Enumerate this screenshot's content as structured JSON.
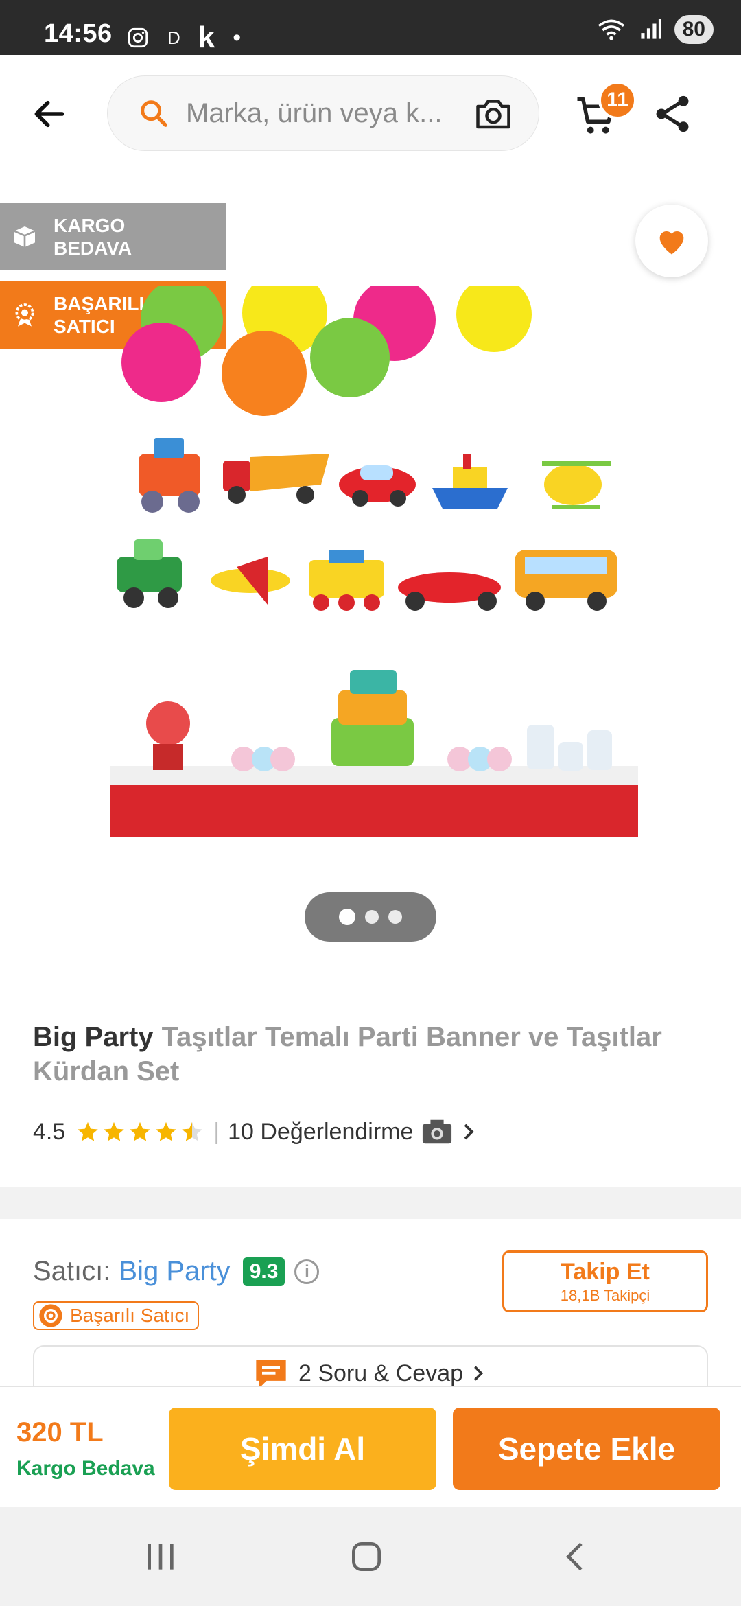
{
  "status_bar": {
    "time": "14:56",
    "notif_letter_d": "D",
    "notif_letter_k": "k",
    "dot": "•",
    "battery": "80"
  },
  "header": {
    "search_placeholder": "Marka, ürün veya k...",
    "cart_count": "11"
  },
  "gallery": {
    "badge_shipping": "KARGO\nBEDAVA",
    "badge_seller": "BAŞARILI\nSATICI",
    "page_count": 3,
    "active_page": 1
  },
  "product": {
    "brand": "Big Party",
    "name": "Taşıtlar Temalı Parti Banner ve Taşıtlar Kürdan Set",
    "rating": "4.5",
    "rating_value": 4.5,
    "review_label": "10 Değerlendirme",
    "separator": "|"
  },
  "seller": {
    "label": "Satıcı:",
    "name": "Big Party",
    "score": "9.3",
    "badge": "Başarılı Satıcı",
    "follow_label": "Takip Et",
    "followers": "18,1B Takipçi",
    "qa_label": "2 Soru & Cevap"
  },
  "purchase": {
    "price": "320 TL",
    "shipping": "Kargo Bedava",
    "buy_now": "Şimdi Al",
    "add_to_cart": "Sepete Ekle"
  },
  "colors": {
    "accent": "#f27a1a",
    "buy_now": "#fbb01d",
    "success": "#1aa053",
    "link": "#4a90d9"
  }
}
